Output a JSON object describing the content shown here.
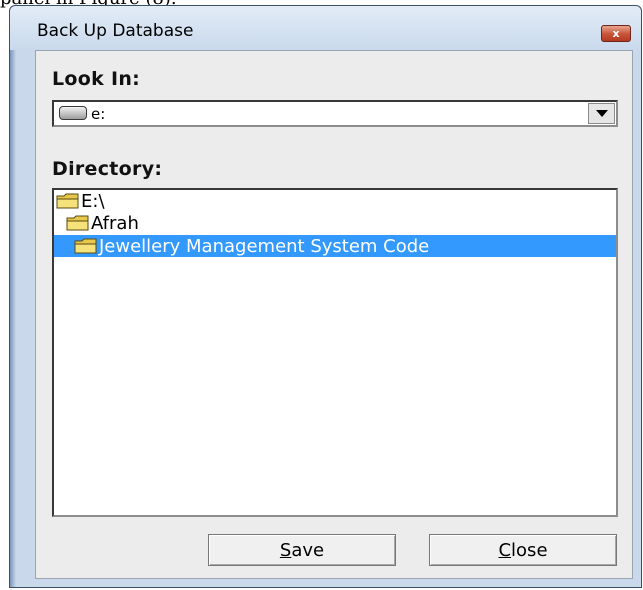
{
  "page_caption": "panel in Figure (8).",
  "window": {
    "title": "Back Up Database",
    "close_glyph": "x"
  },
  "look_in": {
    "label": "Look In:",
    "value": "e:"
  },
  "directory": {
    "label": "Directory:",
    "items": [
      {
        "label": "E:\\",
        "selected": false
      },
      {
        "label": "Afrah",
        "selected": false
      },
      {
        "label": "Jewellery Management System Code",
        "selected": true
      }
    ]
  },
  "buttons": {
    "save_mnemonic": "S",
    "save_rest": "ave",
    "close_mnemonic": "C",
    "close_rest": "lose"
  },
  "colors": {
    "selection": "#3399ff",
    "title_close": "#c75238",
    "folder": "#f0d060"
  },
  "icons": [
    "drive-icon",
    "folder-icon",
    "chevron-down-icon",
    "close-icon"
  ]
}
